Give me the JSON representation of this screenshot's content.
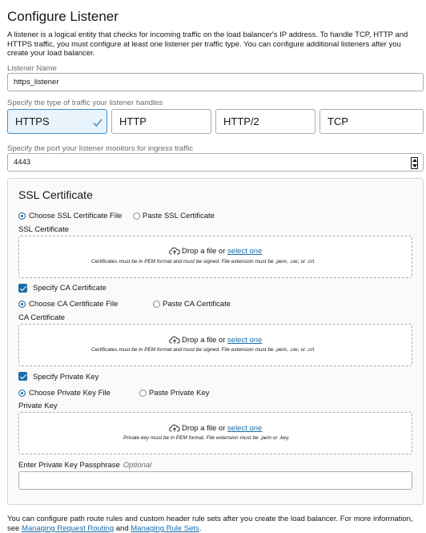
{
  "page": {
    "title": "Configure Listener",
    "description": "A listener is a logical entity that checks for incoming traffic on the load balancer's IP address. To handle TCP, HTTP and HTTPS traffic, you must configure at least one listener per traffic type. You can configure additional listeners after you create your load balancer."
  },
  "listener_name": {
    "label": "Listener Name",
    "value": "https_listener"
  },
  "traffic_type": {
    "label": "Specify the type of traffic your listener handles",
    "options": [
      "HTTPS",
      "HTTP",
      "HTTP/2",
      "TCP"
    ],
    "selected": "HTTPS"
  },
  "port": {
    "label": "Specify the port your listener monitors for ingress traffic",
    "value": "4443"
  },
  "ssl": {
    "title": "SSL Certificate",
    "choose_file_label": "Choose SSL Certificate File",
    "paste_label": "Paste SSL Certificate",
    "field_label": "SSL Certificate",
    "drop_text": "Drop a file or",
    "select_link": "select one",
    "note": "Certificates must be in PEM format and must be signed. File extension must be .pem, .cer, or .crt."
  },
  "ca": {
    "checkbox_label": "Specify CA Certificate",
    "choose_file_label": "Choose CA Certificate File",
    "paste_label": "Paste CA Certificate",
    "field_label": "CA Certificate",
    "drop_text": "Drop a file or",
    "select_link": "select one",
    "note": "Certificates must be in PEM format and must be signed. File extension must be .pem, .cer, or .crt."
  },
  "private_key": {
    "checkbox_label": "Specify Private Key",
    "choose_file_label": "Choose Private Key File",
    "paste_label": "Paste Private Key",
    "field_label": "Private Key",
    "drop_text": "Drop a file or",
    "select_link": "select one",
    "note": "Private key must be in PEM format. File extension must be .pem or .key.",
    "passphrase_label": "Enter Private Key Passphrase",
    "passphrase_optional": "Optional",
    "passphrase_value": ""
  },
  "footer": {
    "text": "You can configure path route rules and custom header rule sets after you create the load balancer. For more information, see",
    "link1": "Managing Request Routing",
    "and": "and",
    "link2": "Managing Rule Sets",
    "end": "."
  },
  "colors": {
    "accent": "#1b6ca8",
    "selected_border": "#3d8fcb",
    "selected_bg": "#e9f3fb"
  }
}
